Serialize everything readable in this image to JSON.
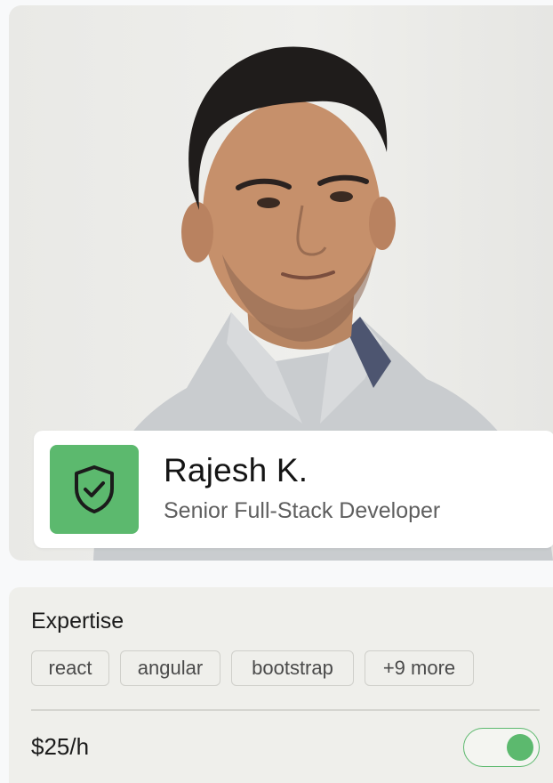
{
  "profile": {
    "name": "Rajesh K.",
    "title": "Senior Full-Stack Developer",
    "badge_icon": "shield-check-icon",
    "badge_color": "#5cb96e",
    "photo_alt": "Portrait of Rajesh K."
  },
  "expertise": {
    "heading": "Expertise",
    "skills": [
      "react",
      "angular",
      "bootstrap"
    ],
    "more_label": "+9 more"
  },
  "rate": {
    "label": "$25/h",
    "toggle_on": true
  }
}
